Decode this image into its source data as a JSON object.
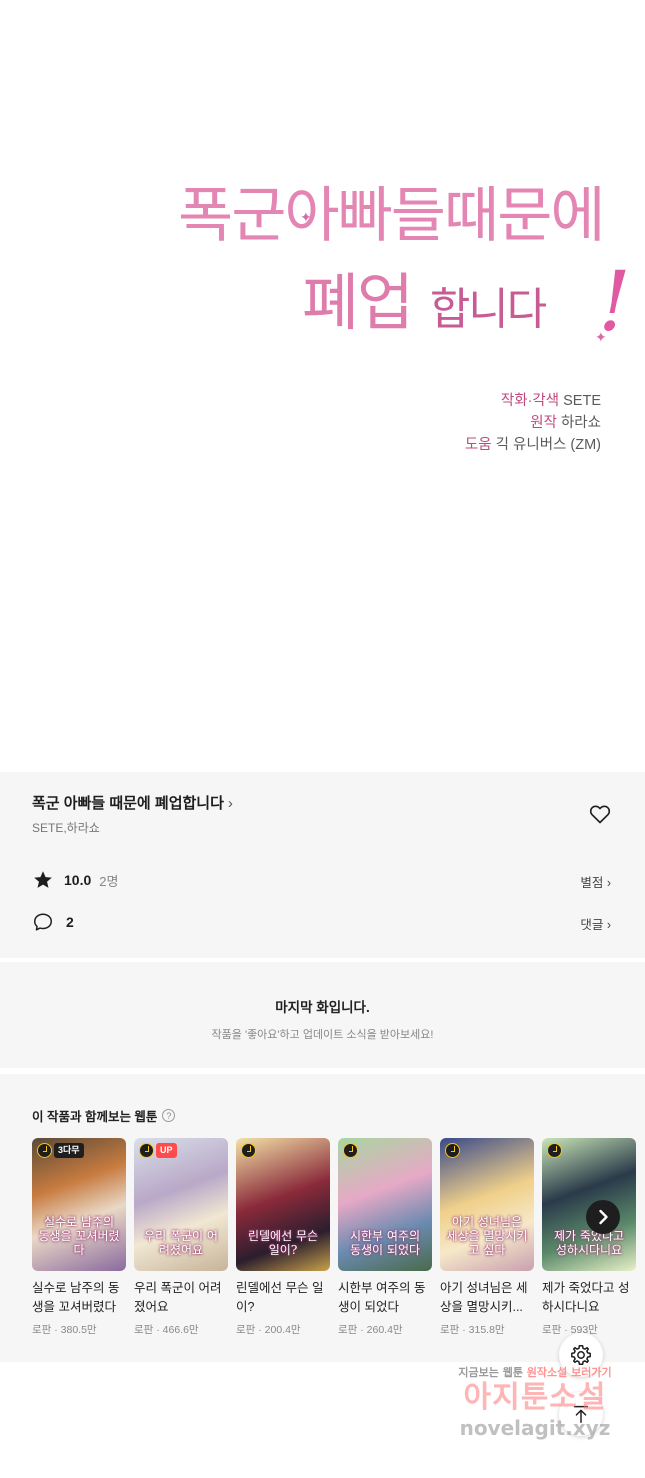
{
  "cover": {
    "logo_line1": "폭군아빠들때문에",
    "logo_line2_big": "폐업",
    "logo_line2_small": "합니다",
    "logo_exclaim": "!",
    "credits": [
      {
        "role": "작화·각색",
        "name": "SETE"
      },
      {
        "role": "원작",
        "name": "하라쇼"
      },
      {
        "role": "도움",
        "name": "긱 유니버스 (ZM)"
      }
    ]
  },
  "info": {
    "title": "폭군 아빠들 때문에 폐업합니다",
    "title_chevron": "›",
    "authors": "SETE,하라쇼",
    "rating": "10.0",
    "rating_count": "2명",
    "rate_link": "별점 ›",
    "comment_count": "2",
    "comment_link": "댓글 ›"
  },
  "last_episode": {
    "heading": "마지막 화입니다.",
    "sub": "작품을 '좋아요'하고 업데이트 소식을 받아보세요!"
  },
  "recommendations": {
    "heading": "이 작품과 함께보는 웹툰",
    "help_icon": "?",
    "items": [
      {
        "cover_text": "실수로 남주의 동생을 꼬셔버렸다",
        "badge": "3다무",
        "badge_style": "dark",
        "name": "실수로 남주의 동생을 꼬셔버렸다",
        "meta": "로판 · 380.5만",
        "bg": "linear-gradient(160deg,#5b4a3a 0%,#c77b3f 35%,#e9d8c6 60%,#8a6a9e 100%)"
      },
      {
        "cover_text": "우리 폭군이 어려졌어요",
        "badge": "UP",
        "badge_style": "red",
        "name": "우리 폭군이 어려졌어요",
        "meta": "로판 · 466.6만",
        "bg": "linear-gradient(160deg,#d9dfe8 0%,#b9a8c8 40%,#f1e7d2 65%,#c6b39a 100%)"
      },
      {
        "cover_text": "린델에선 무슨 일이?",
        "badge": "",
        "badge_style": "",
        "name": "린델에선 무슨 일이?",
        "meta": "로판 · 200.4만",
        "bg": "linear-gradient(160deg,#f3e2a8 0%,#8a2a3a 45%,#2b1e2e 75%,#c9a24a 100%)"
      },
      {
        "cover_text": "시한부 여주의 동생이 되었다",
        "badge": "",
        "badge_style": "",
        "name": "시한부 여주의 동생이 되었다",
        "meta": "로판 · 260.4만",
        "bg": "linear-gradient(160deg,#a8d6a0 0%,#e6a9c6 40%,#6a8ab0 70%,#4a6a4a 100%)"
      },
      {
        "cover_text": "아기 성녀님은 세상을 멸망시키고 싶다",
        "badge": "",
        "badge_style": "",
        "name": "아기 성녀님은 세상을 멸망시키...",
        "meta": "로판 · 315.8만",
        "bg": "linear-gradient(160deg,#3a4a8a 0%,#f0d08a 45%,#f6e8c8 70%,#c8a0b0 100%)"
      },
      {
        "cover_text": "제가 죽었다고 성하시다니요",
        "badge": "",
        "badge_style": "",
        "name": "제가 죽었다고 성하시다니요",
        "meta": "로판 · 593만",
        "bg": "linear-gradient(160deg,#c9e6b8 0%,#2a3a4a 40%,#5a8a6a 70%,#e8f0c8 100%)"
      }
    ]
  },
  "watermark": {
    "line1_a": "지금보는 웹툰",
    "line1_b": "원작소설",
    "line1_c": "보러가기",
    "line2": "아지툰소설",
    "line3": "novelagit.xyz"
  }
}
